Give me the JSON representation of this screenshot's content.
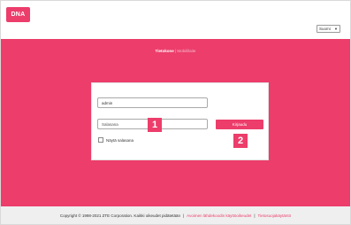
{
  "header": {
    "logo_text": "DNA",
    "language": "Suomi"
  },
  "modes": {
    "active": "Tietokone",
    "separator": "|",
    "inactive": "Mobiililaite"
  },
  "login": {
    "username_value": "admin",
    "password_placeholder": "Salasana",
    "show_password_label": "Näytä salasana",
    "submit_label": "Kirjaudu"
  },
  "annotations": {
    "badge_1": "1",
    "badge_2": "2"
  },
  "footer": {
    "copyright": "Copyright © 1998-2021 ZTE Corporation. Kaikki oikeudet pidätetään",
    "separator": "|",
    "link_1": "Avoimen lähdekoodin käyttöoikeudet",
    "link_2": "Tietosuojakäytäntö"
  },
  "colors": {
    "accent": "#ec3d6b",
    "footer_bg": "#efefef"
  },
  "icons": {
    "language_caret": "chevron-down-icon",
    "checkbox": "checkbox-icon"
  }
}
